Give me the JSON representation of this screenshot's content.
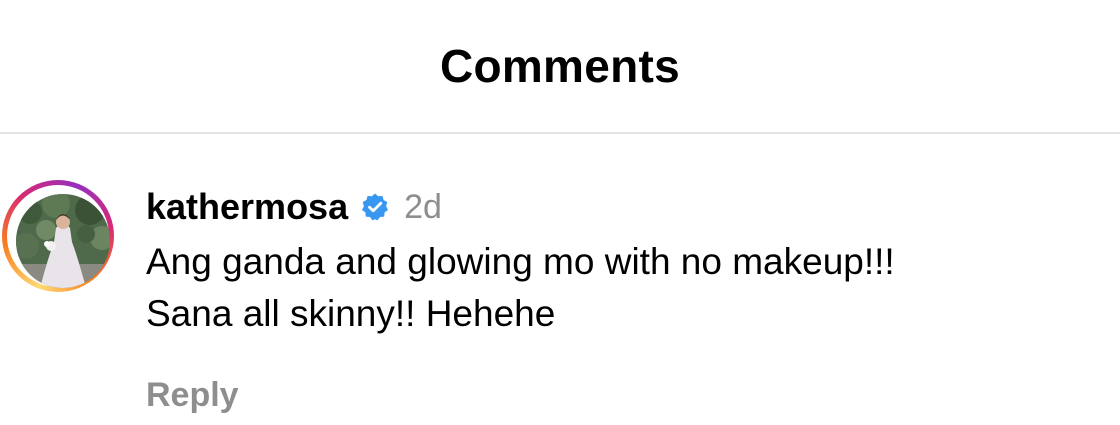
{
  "header": {
    "title": "Comments"
  },
  "comment": {
    "username": "kathermosa",
    "verified": true,
    "verified_icon": "verified-badge-icon",
    "time": "2d",
    "text": "Ang ganda and glowing mo with no makeup!!!\nSana all skinny!! Hehehe",
    "reply_label": "Reply",
    "avatar_icon": "user-avatar"
  },
  "colors": {
    "verified_blue": "#3897f0",
    "muted_text": "#8e8e8e",
    "divider": "#e3e3e3",
    "story_ring_start": "#feda75",
    "story_ring_end": "#962fbf"
  }
}
